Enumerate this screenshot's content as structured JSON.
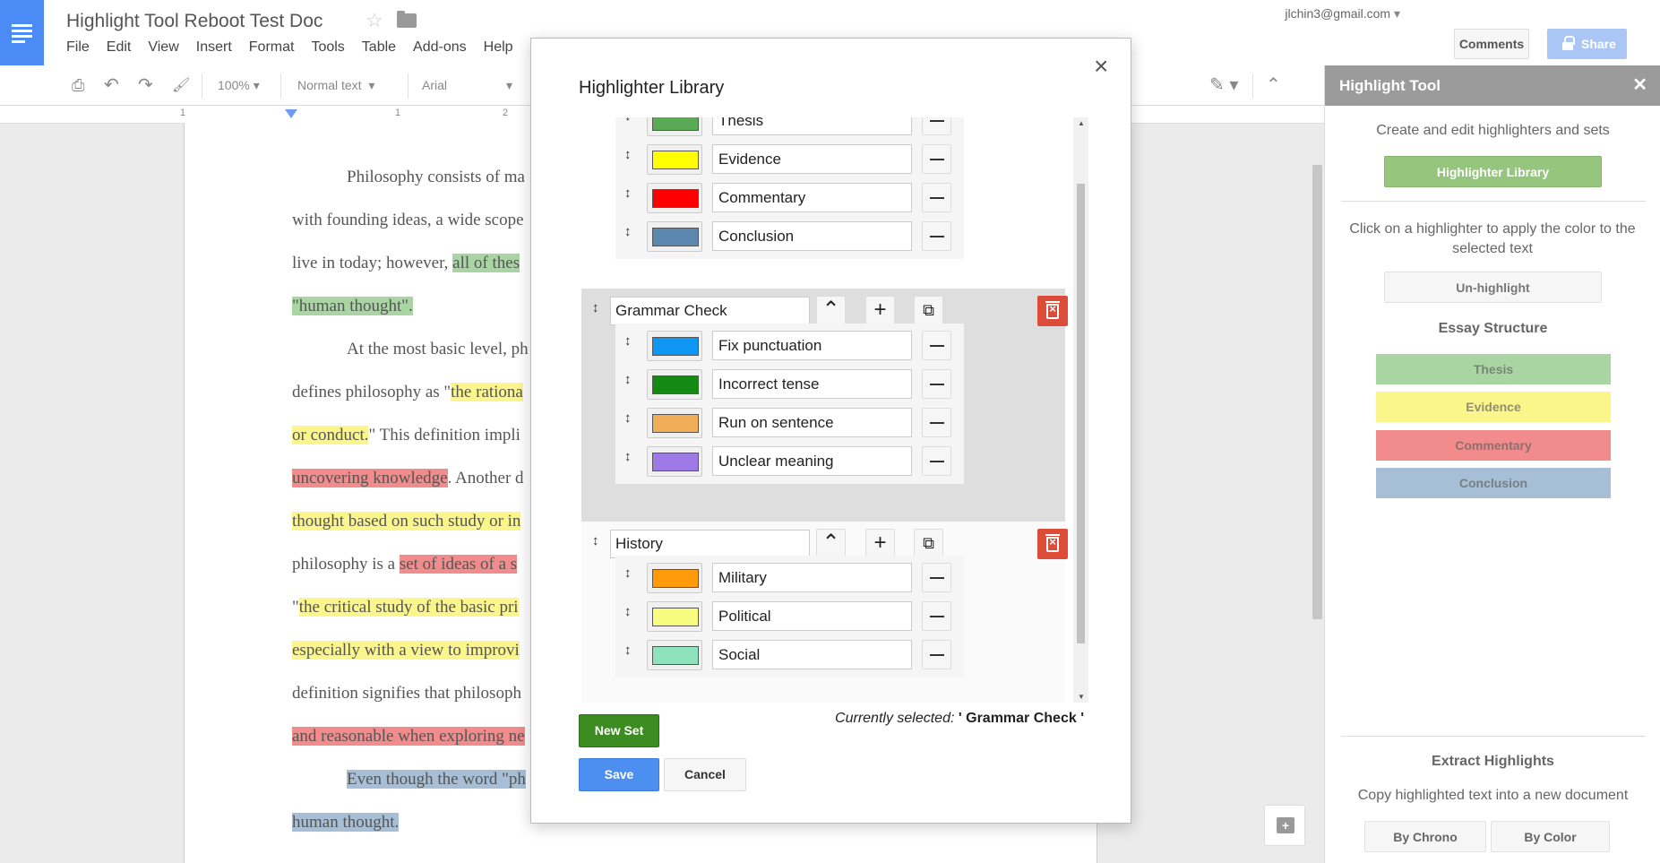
{
  "doc": {
    "title": "Highlight Tool Reboot Test Doc",
    "menu": [
      "File",
      "Edit",
      "View",
      "Insert",
      "Format",
      "Tools",
      "Table",
      "Add-ons",
      "Help"
    ],
    "account": "jlchin3@gmail.com",
    "comments_label": "Comments",
    "share_label": "Share",
    "zoom": "100%",
    "style": "Normal text",
    "font": "Arial",
    "ruler_ticks": [
      "1",
      "1",
      "2"
    ],
    "lines": [
      [
        {
          "t": "Philosophy consists of ma",
          "h": ""
        }
      ],
      [
        {
          "t": "with founding ideas, a wide scope",
          "h": ""
        }
      ],
      [
        {
          "t": "live in today; however, ",
          "h": ""
        },
        {
          "t": "all of thes",
          "h": "green"
        }
      ],
      [
        {
          "t": "\"human thought\".",
          "h": "green"
        }
      ],
      [
        {
          "t": "At the most basic level, ph",
          "h": ""
        }
      ],
      [
        {
          "t": "defines philosophy as \"",
          "h": ""
        },
        {
          "t": "the rationa",
          "h": "yellow"
        }
      ],
      [
        {
          "t": "or conduct.",
          "h": "yellow"
        },
        {
          "t": "\" This definition impli",
          "h": ""
        }
      ],
      [
        {
          "t": "uncovering knowledge",
          "h": "red"
        },
        {
          "t": ". Another d",
          "h": ""
        }
      ],
      [
        {
          "t": "thought based on such study or in",
          "h": "yellow"
        }
      ],
      [
        {
          "t": "philosophy is a ",
          "h": ""
        },
        {
          "t": "set of ideas of a s",
          "h": "red"
        }
      ],
      [
        {
          "t": "\"",
          "h": ""
        },
        {
          "t": "the critical study of the basic pri",
          "h": "yellow"
        }
      ],
      [
        {
          "t": "especially with a view to improvi",
          "h": "yellow"
        }
      ],
      [
        {
          "t": "definition signifies that philosoph",
          "h": ""
        }
      ],
      [
        {
          "t": "and reasonable when exploring ne",
          "h": "red"
        }
      ],
      [
        {
          "t": "Even though the word \"ph",
          "h": "blue"
        }
      ],
      [
        {
          "t": "human thought.",
          "h": "blue"
        }
      ]
    ]
  },
  "sidebar": {
    "title": "Highlight Tool",
    "create_text": "Create and edit highlighters and sets",
    "library_button": "Highlighter Library",
    "apply_text": "Click on a highlighter to apply the color to the selected text",
    "unhighlight_button": "Un-highlight",
    "set_title": "Essay Structure",
    "highlighters": [
      {
        "label": "Thesis",
        "color": "#a8d5a2"
      },
      {
        "label": "Evidence",
        "color": "#fbf68b"
      },
      {
        "label": "Commentary",
        "color": "#f28b8b"
      },
      {
        "label": "Conclusion",
        "color": "#a6bfd6"
      }
    ],
    "extract_title": "Extract Highlights",
    "extract_text": "Copy highlighted text into a new document",
    "by_chrono": "By Chrono",
    "by_color": "By Color"
  },
  "modal": {
    "title": "Highlighter Library",
    "first_set_rows": [
      {
        "name": "Thesis",
        "color": "#5aaa55"
      },
      {
        "name": "Evidence",
        "color": "#ffff00"
      },
      {
        "name": "Commentary",
        "color": "#ff0000"
      },
      {
        "name": "Conclusion",
        "color": "#5b86ad"
      }
    ],
    "grammar_set": {
      "name": "Grammar Check",
      "rows": [
        {
          "name": "Fix punctuation",
          "color": "#0d96f2"
        },
        {
          "name": "Incorrect tense",
          "color": "#148a14"
        },
        {
          "name": "Run on sentence",
          "color": "#f0ad5a"
        },
        {
          "name": "Unclear meaning",
          "color": "#9d7ae6"
        }
      ]
    },
    "history_set": {
      "name": "History",
      "rows": [
        {
          "name": "Military",
          "color": "#ff9a0a"
        },
        {
          "name": "Political",
          "color": "#f7fb7f"
        },
        {
          "name": "Social",
          "color": "#8ee3be"
        }
      ]
    },
    "new_set_label": "New Set",
    "current_selected_prefix": "Currently selected:",
    "current_selected_value": "' Grammar Check '",
    "save_label": "Save",
    "cancel_label": "Cancel"
  }
}
